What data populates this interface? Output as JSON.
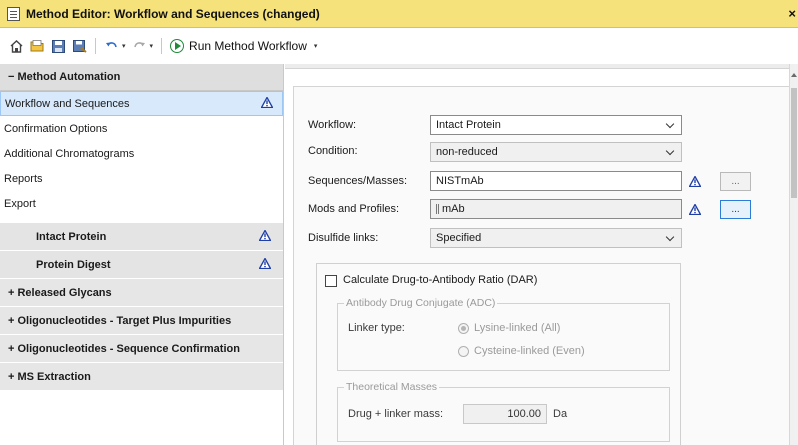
{
  "window": {
    "title": "Method Editor: Workflow and Sequences (changed)",
    "close_glyph": "×"
  },
  "toolbar": {
    "icons": [
      "home-icon",
      "open-icon",
      "save-icon",
      "save-as-icon",
      "undo-icon",
      "redo-icon"
    ],
    "run_label": "Run Method Workflow",
    "dropdown_glyph": "▾"
  },
  "sidebar": {
    "section_header": "− Method Automation",
    "items": [
      {
        "label": "Workflow and Sequences",
        "selected": true,
        "warning": true
      },
      {
        "label": "Confirmation Options"
      },
      {
        "label": "Additional Chromatograms"
      },
      {
        "label": "Reports"
      },
      {
        "label": "Export"
      }
    ],
    "sub_headers": [
      {
        "label": "Intact Protein",
        "warning": true
      },
      {
        "label": "Protein Digest",
        "warning": true
      }
    ],
    "collapsed_sections": [
      "+ Released Glycans",
      "+ Oligonucleotides - Target Plus Impurities",
      "+ Oligonucleotides - Sequence Confirmation",
      "+ MS Extraction"
    ]
  },
  "form": {
    "workflow": {
      "label": "Workflow:",
      "value": "Intact Protein"
    },
    "condition": {
      "label": "Condition:",
      "value": "non-reduced"
    },
    "sequences": {
      "label": "Sequences/Masses:",
      "value": "NISTmAb",
      "button": "..."
    },
    "mods": {
      "label": "Mods and Profiles:",
      "value": "mAb",
      "button": "..."
    },
    "disulfide": {
      "label": "Disulfide links:",
      "value": "Specified"
    },
    "dar": {
      "checkbox_label": "Calculate Drug-to-Antibody Ratio (DAR)",
      "checked": false,
      "adc_group": {
        "title": "Antibody Drug Conjugate (ADC)",
        "linker_label": "Linker type:",
        "options": [
          {
            "label": "Lysine-linked (All)",
            "checked": true
          },
          {
            "label": "Cysteine-linked (Even)",
            "checked": false
          }
        ]
      },
      "masses_group": {
        "title": "Theoretical Masses",
        "mass_label": "Drug + linker mass:",
        "mass_value": "100.00",
        "unit": "Da"
      }
    }
  },
  "colors": {
    "title_bar": "#f6e27a",
    "selected_item": "#d7e9fb",
    "warning_icon": "#1f3fa8",
    "run_icon": "#1e8a3a"
  }
}
